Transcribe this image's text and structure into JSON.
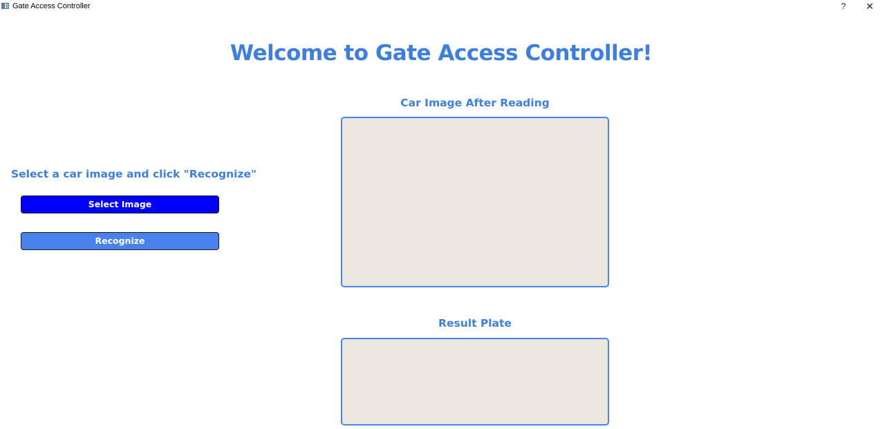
{
  "window": {
    "title": "Gate Access Controller",
    "help_label": "?",
    "close_label": "✕"
  },
  "main": {
    "welcome_title": "Welcome to Gate Access Controller!",
    "instruction": "Select a car image and click \"Recognize\"",
    "select_button": "Select Image",
    "recognize_button": "Recognize",
    "car_image_label": "Car Image After Reading",
    "result_plate_label": "Result Plate"
  },
  "colors": {
    "accent": "#3c7fe0",
    "select_button": "#0000ff",
    "recognize_button": "#4a82ec",
    "panel_background": "#ebe7de",
    "panel_border": "#4a82ec"
  },
  "icons": {
    "app": "app-window-icon",
    "help": "help-icon",
    "close": "close-icon"
  }
}
